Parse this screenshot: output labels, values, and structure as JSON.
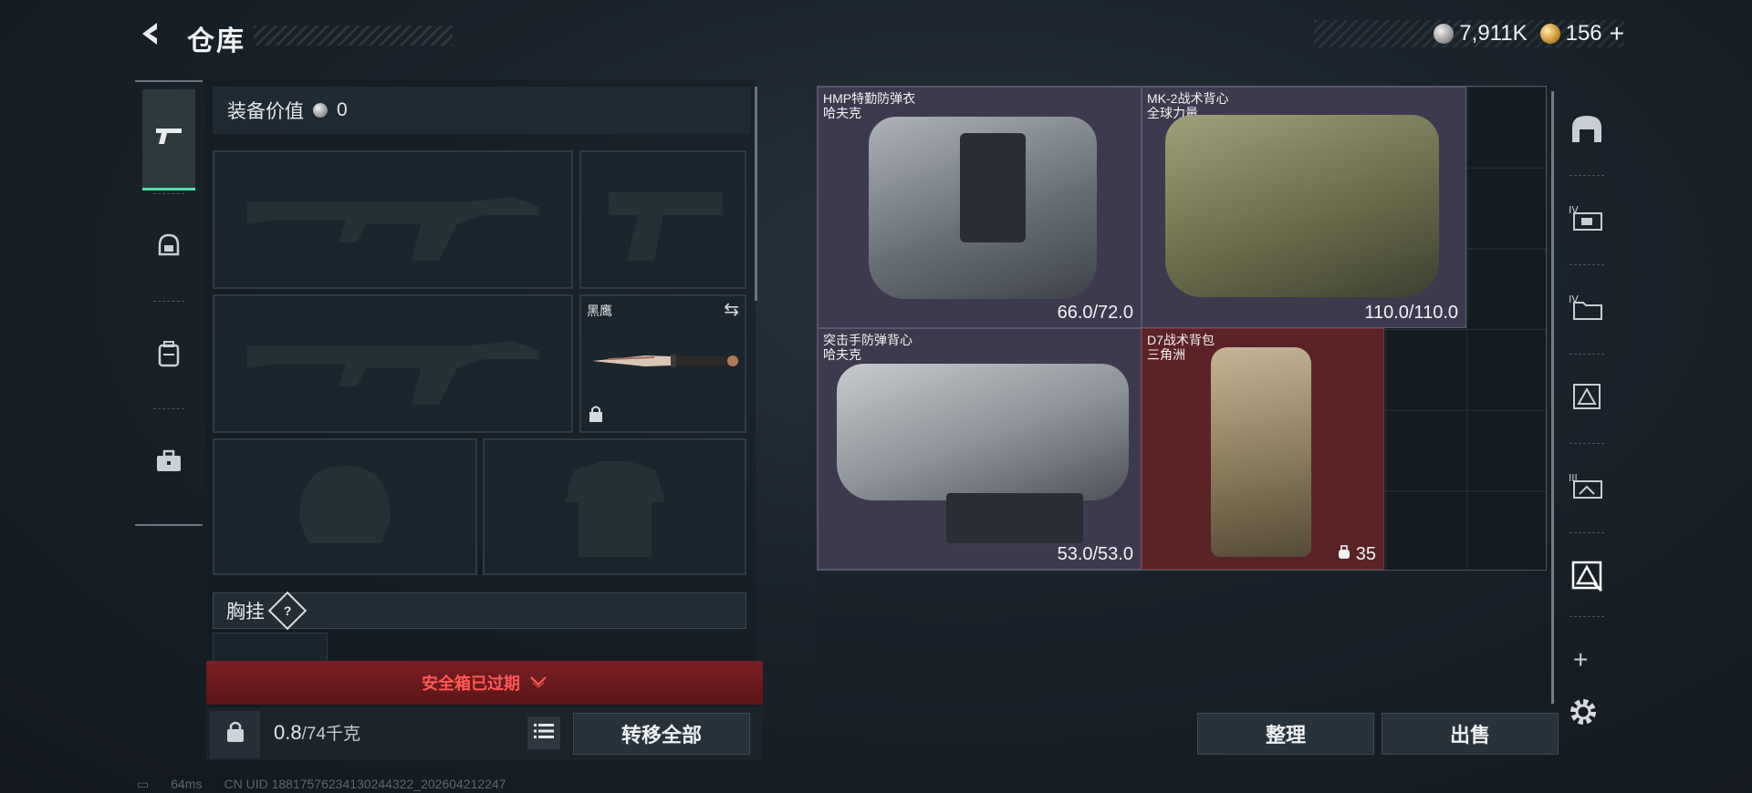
{
  "header": {
    "back_icon": "arrow-left-icon",
    "title": "仓库",
    "currency": {
      "silver": "7,911K",
      "gold": "156",
      "plus": "+"
    }
  },
  "left_rail": {
    "categories": [
      {
        "name": "weapons",
        "icon": "pistol-icon",
        "active": true
      },
      {
        "name": "armor",
        "icon": "helmet-icon",
        "active": false
      },
      {
        "name": "backpack",
        "icon": "backpack-icon",
        "active": false
      },
      {
        "name": "cases",
        "icon": "briefcase-icon",
        "active": false
      }
    ]
  },
  "equipment": {
    "value_label": "装备价值",
    "value": "0",
    "melee_name": "黑鹰",
    "chest_label": "胸挂",
    "chest_help": "?",
    "safe_box": "安全箱已过期",
    "weight_current": "0.8",
    "weight_max": "/74千克",
    "transfer_all": "转移全部"
  },
  "grid": {
    "items": [
      {
        "name": "HMP特勤防弹衣",
        "brand": "哈夫克",
        "durability": "66.0/72.0"
      },
      {
        "name": "MK-2战术背心",
        "brand": "全球力量",
        "durability": "110.0/110.0"
      },
      {
        "name": "突击手防弹背心",
        "brand": "哈夫克",
        "durability": "53.0/53.0"
      },
      {
        "name": "D7战术背包",
        "brand": "三角洲",
        "capacity": "35"
      }
    ],
    "sort": "整理",
    "sell": "出售"
  },
  "right_rail": {
    "tabs": [
      "bunker-icon",
      "case-iv-icon",
      "folder-iv-icon",
      "storage-triangle-icon",
      "case-iii-icon",
      "storage-active-icon"
    ],
    "add": "+",
    "settings_icon": "gear-icon"
  },
  "status": {
    "ping": "64ms",
    "uid": "CN UID 18817576234130244322_202604212247"
  }
}
